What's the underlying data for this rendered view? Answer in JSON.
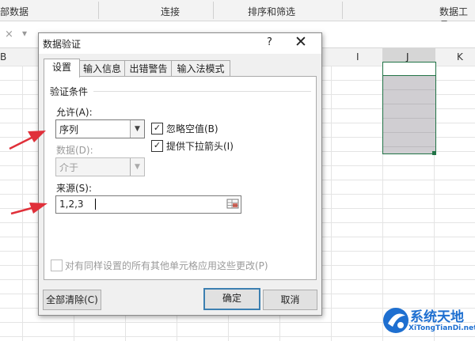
{
  "ribbon": {
    "groups": [
      "部数据",
      "连接",
      "排序和筛选",
      "数据工具"
    ]
  },
  "formula_bar": {
    "cancel_icon": "×",
    "dropdown_icon": "▾"
  },
  "columns": {
    "b_partial": "B",
    "i": "I",
    "j": "J",
    "k": "K"
  },
  "dialog": {
    "title": "数据验证",
    "help_label": "?",
    "close_label": "✕",
    "tabs": [
      {
        "label": "设置",
        "active": true
      },
      {
        "label": "输入信息",
        "active": false
      },
      {
        "label": "出错警告",
        "active": false
      },
      {
        "label": "输入法模式",
        "active": false
      }
    ],
    "settings": {
      "group_title": "验证条件",
      "allow_label": "允许(A):",
      "allow_value": "序列",
      "data_label": "数据(D):",
      "data_value": "介于",
      "ignore_blank_label": "忽略空值(B)",
      "ignore_blank_checked": true,
      "dropdown_label": "提供下拉箭头(I)",
      "dropdown_checked": true,
      "source_label": "来源(S):",
      "source_value": "1,2,3",
      "apply_all_label": "对有同样设置的所有其他单元格应用这些更改(P)",
      "apply_all_checked": false
    },
    "buttons": {
      "clear_all": "全部清除(C)",
      "ok": "确定",
      "cancel": "取消"
    }
  },
  "watermark": {
    "main": "系统天地",
    "sub": "XiTongTianDi.net"
  },
  "colors": {
    "excel_green": "#217346",
    "arrow_red": "#e0303a",
    "watermark_blue": "#1e6fd0"
  }
}
